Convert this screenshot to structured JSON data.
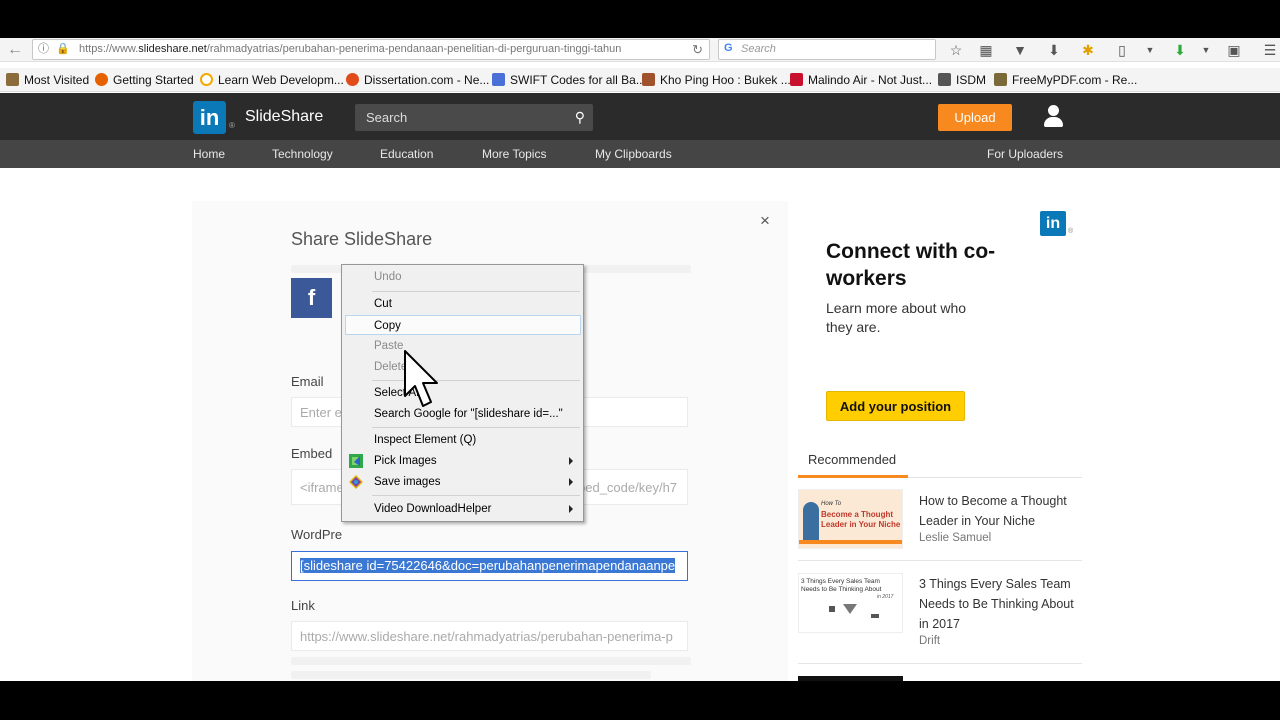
{
  "browser": {
    "url_prefix": "https://www.",
    "url_domain": "slideshare.net",
    "url_path": "/rahmadyatrias/perubahan-penerima-pendanaan-penelitian-di-perguruan-tinggi-tahun",
    "search_placeholder": "Search"
  },
  "bookmarks": [
    {
      "label": "Most Visited",
      "color": "#8b6d3b"
    },
    {
      "label": "Getting Started",
      "color": "#e66000"
    },
    {
      "label": "Learn Web Developm...",
      "color": "#f2a900"
    },
    {
      "label": "Dissertation.com - Ne...",
      "color": "#e04b1a"
    },
    {
      "label": "SWIFT Codes for all Ba...",
      "color": "#4a6fd6"
    },
    {
      "label": "Kho Ping Hoo : Bukek ...",
      "color": "#a0522d"
    },
    {
      "label": "Malindo Air - Not Just...",
      "color": "#c8102e"
    },
    {
      "label": "ISDM",
      "color": "#555555"
    },
    {
      "label": "FreeMyPDF.com - Re...",
      "color": "#7a6a3a"
    }
  ],
  "header": {
    "logo_text": "in",
    "logo_reg": "®",
    "brand": "SlideShare",
    "search_placeholder": "Search",
    "upload_label": "Upload"
  },
  "menu": {
    "items": [
      "Home",
      "Technology",
      "Education",
      "More Topics",
      "My Clipboards"
    ],
    "right_item": "For Uploaders"
  },
  "modal": {
    "title": "Share SlideShare",
    "close": "×",
    "facebook": "f",
    "email_label": "Email",
    "email_placeholder": "Enter e",
    "embed_label": "Embed",
    "embed_left": "<iframe",
    "embed_right": "bed_code/key/h7",
    "wordpress_label": "WordPre",
    "wordpress_value": "[slideshare id=75422646&doc=perubahanpenerimapendanaanpe",
    "link_label": "Link",
    "link_value": "https://www.slideshare.net/rahmadyatrias/perubahan-penerima-p"
  },
  "context_menu": {
    "items": [
      {
        "label": "Undo",
        "disabled": true
      },
      {
        "label": "Cut",
        "disabled": false
      },
      {
        "label": "Copy",
        "disabled": false,
        "highlight": true
      },
      {
        "label": "Paste",
        "disabled": true
      },
      {
        "label": "Delete",
        "disabled": true
      },
      {
        "label": "Select All",
        "disabled": false
      },
      {
        "label": "Search Google for \"[slideshare id=...\"",
        "disabled": false
      },
      {
        "label": "Inspect Element (Q)",
        "disabled": false
      },
      {
        "label": "Pick Images",
        "disabled": false,
        "submenu": true,
        "icon": "pick-images-icon"
      },
      {
        "label": "Save images",
        "disabled": false,
        "submenu": true,
        "icon": "save-images-icon"
      },
      {
        "label": "Video DownloadHelper",
        "disabled": false,
        "submenu": true
      }
    ]
  },
  "ad": {
    "logo": "in",
    "logo_reg": "®",
    "title": "Connect with co-workers",
    "subtitle": "Learn more about who they are.",
    "button": "Add your position"
  },
  "recommended": {
    "tab": "Recommended",
    "items": [
      {
        "title": "How to Become a Thought Leader in Your Niche",
        "author": "Leslie Samuel",
        "thumb_line1": "How To",
        "thumb_line2": "Become a Thought",
        "thumb_line3": "Leader in Your Niche"
      },
      {
        "title": "3 Things Every Sales Team Needs to Be Thinking About in 2017",
        "author": "Drift",
        "thumb_line1": "3 Things Every Sales Team",
        "thumb_line2": "Needs to Be Thinking About",
        "thumb_line3": "in 2017"
      }
    ]
  },
  "colors": {
    "linkedin_blue": "#0b78b7",
    "upload_orange": "#f7891f",
    "ad_yellow": "#ffcd00",
    "facebook_blue": "#3b5998",
    "selection_blue": "#3a78d4"
  }
}
